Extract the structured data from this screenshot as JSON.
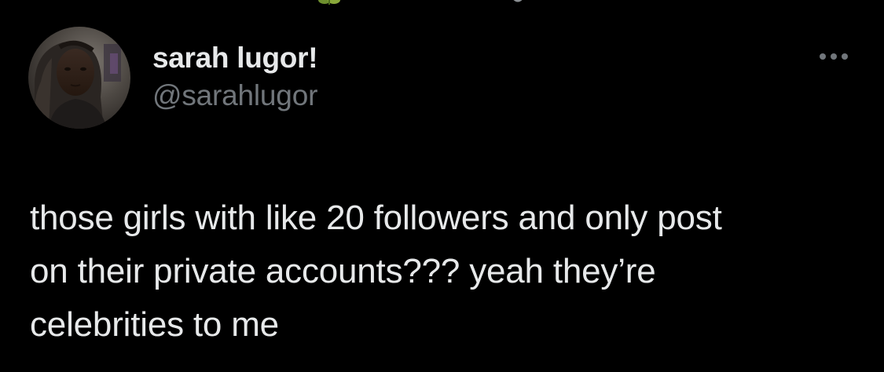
{
  "tweet": {
    "author": {
      "display_name": "sarah lugor!",
      "handle": "@sarahlugor",
      "avatar_icon": "profile-photo"
    },
    "more_icon": "more-horizontal-icon",
    "text": "those girls with like 20 followers and only post\non their private accounts??? yeah they’re\ncelebrities to me"
  },
  "colors": {
    "background": "#000000",
    "primary_text": "#e7e9ea",
    "secondary_text": "#71767b"
  }
}
